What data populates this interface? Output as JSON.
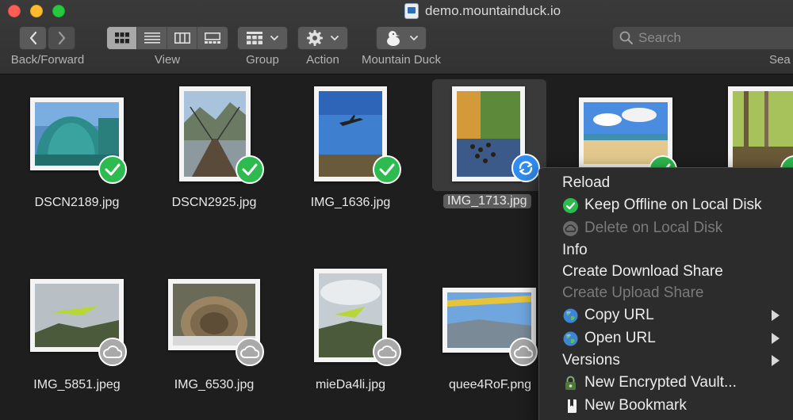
{
  "window": {
    "title": "demo.mountainduck.io"
  },
  "toolbar": {
    "back_forward_label": "Back/Forward",
    "view_label": "View",
    "group_label": "Group",
    "action_label": "Action",
    "mountain_duck_label": "Mountain Duck",
    "search_label": "Sea",
    "search_placeholder": "Search"
  },
  "files": [
    {
      "name": "DSCN2189.jpg",
      "status": "check-icon"
    },
    {
      "name": "DSCN2925.jpg",
      "status": "check-icon"
    },
    {
      "name": "IMG_1636.jpg",
      "status": "check-icon"
    },
    {
      "name": "IMG_1713.jpg",
      "status": "sync-icon",
      "selected": true
    },
    {
      "name": "",
      "status": "check-icon"
    },
    {
      "name": "",
      "status": "check-icon"
    },
    {
      "name": "IMG_5851.jpeg",
      "status": "cloud-icon"
    },
    {
      "name": "IMG_6530.jpg",
      "status": "cloud-icon"
    },
    {
      "name": "mieDa4li.jpg",
      "status": "cloud-icon"
    },
    {
      "name": "quee4RoF.png",
      "status": "cloud-icon"
    }
  ],
  "context_menu": {
    "items": [
      {
        "label": "Reload",
        "icon": null,
        "enabled": true,
        "submenu": false
      },
      {
        "label": "Keep Offline on Local Disk",
        "icon": "green-check-icon",
        "enabled": true,
        "submenu": false
      },
      {
        "label": "Delete on Local Disk",
        "icon": "cloud-icon",
        "enabled": false,
        "submenu": false
      },
      {
        "label": "Info",
        "icon": null,
        "enabled": true,
        "submenu": false
      },
      {
        "label": "Create Download Share",
        "icon": null,
        "enabled": true,
        "submenu": false
      },
      {
        "label": "Create Upload Share",
        "icon": null,
        "enabled": false,
        "submenu": false
      },
      {
        "label": "Copy URL",
        "icon": "globe-icon",
        "enabled": true,
        "submenu": true
      },
      {
        "label": "Open URL",
        "icon": "globe-icon",
        "enabled": true,
        "submenu": true
      },
      {
        "label": "Versions",
        "icon": null,
        "enabled": true,
        "submenu": true
      },
      {
        "label": "New Encrypted Vault...",
        "icon": "vault-icon",
        "enabled": true,
        "submenu": false
      },
      {
        "label": "New Bookmark",
        "icon": "bookmark-icon",
        "enabled": true,
        "submenu": false
      }
    ]
  },
  "colors": {
    "check": "#2dbb4f",
    "sync": "#2f8cf0",
    "cloud": "#a9a9a9"
  }
}
